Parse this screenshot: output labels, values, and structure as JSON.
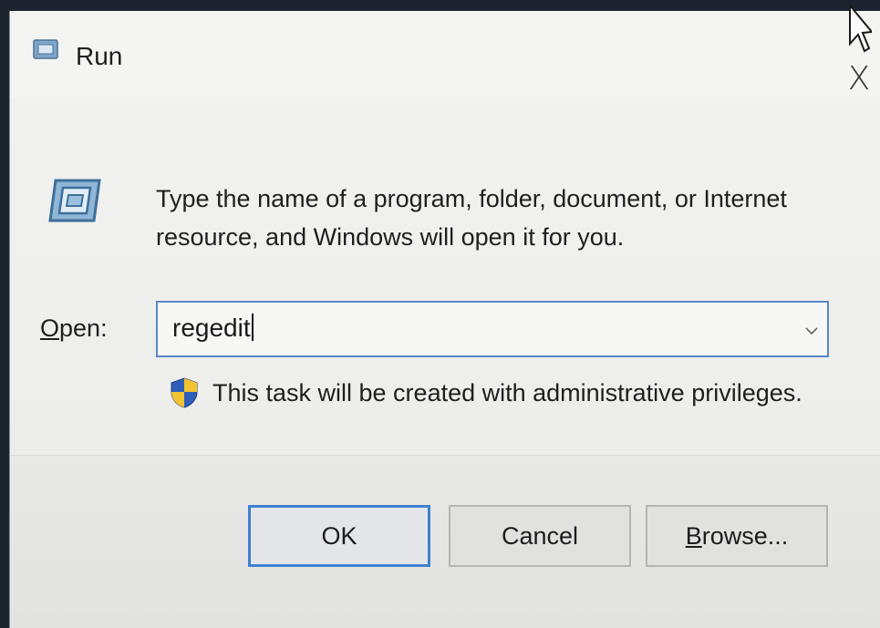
{
  "window": {
    "title": "Run",
    "close_label": "X"
  },
  "body": {
    "description": "Type the name of a program, folder, document, or Internet resource, and Windows will open it for you.",
    "open_label_underlined": "O",
    "open_label_rest": "pen:",
    "input_value": "regedit",
    "admin_note": "This task will be created with administrative privileges."
  },
  "buttons": {
    "ok_label": "OK",
    "cancel_label": "Cancel",
    "browse_underlined": "B",
    "browse_rest": "rowse..."
  },
  "icons": {
    "title": "run-icon",
    "main": "run-icon",
    "shield": "uac-shield-icon",
    "dropdown": "chevron-down-icon",
    "close": "close-icon"
  },
  "colors": {
    "accent": "#3f7fd0",
    "input_border": "#5a87c6"
  }
}
